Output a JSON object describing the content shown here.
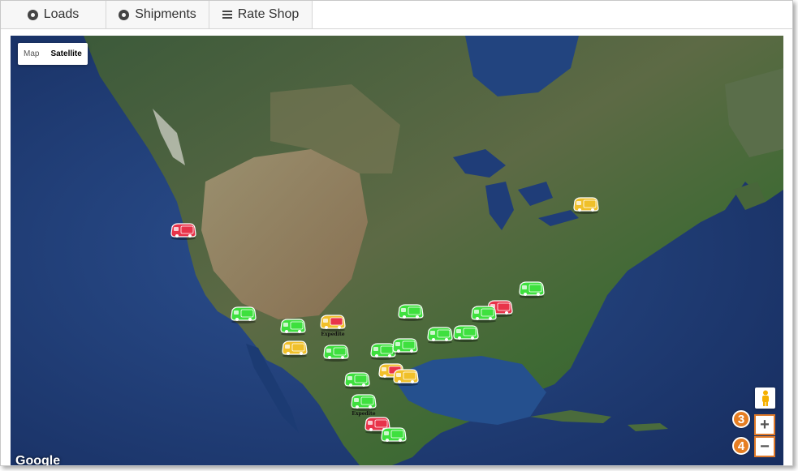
{
  "tabs": [
    {
      "label": "Loads",
      "icon": "radio-ring-icon"
    },
    {
      "label": "Shipments",
      "icon": "radio-ring-icon"
    },
    {
      "label": "Rate Shop",
      "icon": "list-icon"
    }
  ],
  "map": {
    "type_controls": {
      "map_label": "Map",
      "satellite_label": "Satellite",
      "selected": "Satellite"
    },
    "attribution": "Google",
    "zoom_in_label": "+",
    "zoom_out_label": "−",
    "callouts": [
      "3",
      "4"
    ],
    "colors": {
      "ok": "#3ee03e",
      "warning": "#f0c02a",
      "alert": "#e8334a",
      "callout": "#e67e22"
    },
    "markers": [
      {
        "status": "alert",
        "label": ""
      },
      {
        "status": "warning",
        "label": ""
      },
      {
        "status": "ok",
        "label": ""
      },
      {
        "status": "ok",
        "label": ""
      },
      {
        "status": "warning",
        "label": ""
      },
      {
        "status": "mixed",
        "label": "Expedite"
      },
      {
        "status": "ok",
        "label": ""
      },
      {
        "status": "ok",
        "label": ""
      },
      {
        "status": "ok",
        "label": ""
      },
      {
        "status": "ok",
        "label": ""
      },
      {
        "status": "ok",
        "label": ""
      },
      {
        "status": "mixed",
        "label": ""
      },
      {
        "status": "alert",
        "label": ""
      },
      {
        "status": "ok",
        "label": ""
      },
      {
        "status": "ok",
        "label": ""
      },
      {
        "status": "warning",
        "label": ""
      },
      {
        "status": "ok",
        "label": "Expedite"
      },
      {
        "status": "ok",
        "label": ""
      },
      {
        "status": "alert",
        "label": ""
      },
      {
        "status": "ok",
        "label": ""
      },
      {
        "status": "ok",
        "label": ""
      }
    ]
  }
}
